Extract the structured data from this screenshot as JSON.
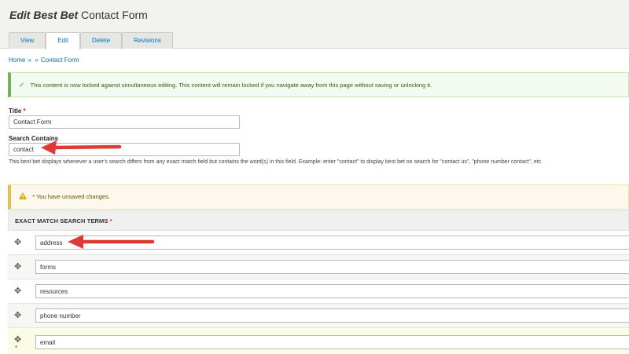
{
  "header": {
    "title_prefix": "Edit",
    "title_type": "Best Bet",
    "title_name": "Contact Form"
  },
  "tabs": [
    {
      "label": "View"
    },
    {
      "label": "Edit",
      "active": true
    },
    {
      "label": "Delete"
    },
    {
      "label": "Revisions"
    }
  ],
  "breadcrumb": {
    "home": "Home",
    "sep1": "»",
    "sep2": "»",
    "current": "Contact Form"
  },
  "status": {
    "text": "This content is now locked against simultaneous editing. This content will remain locked if you navigate away from this page without saving or unlocking it."
  },
  "form": {
    "title_label": "Title",
    "title_required": "*",
    "title_value": "Contact Form",
    "search_label": "Search Contains",
    "search_value": "contact",
    "search_description": "This best bet displays whenever a user's search differs from any exact match field but contains the word(s) in this field. Example: enter \"contact\" to display best bet on search for \"contact us\", \"phone number contact\", etc."
  },
  "warning": {
    "marker": "*",
    "text": "You have unsaved changes."
  },
  "exact_match": {
    "header": "EXACT MATCH SEARCH TERMS",
    "required": "*",
    "changed_marker": "*",
    "terms": [
      "address",
      "forms",
      "resources",
      "phone number",
      "email"
    ]
  },
  "colors": {
    "link": "#0074bd",
    "status_border": "#77b259",
    "warning_border": "#e0c050",
    "annotation_arrow": "#e03a36"
  },
  "icons": {
    "drag": "drag-handle-icon",
    "check": "checkmark-icon",
    "warning": "warning-icon"
  }
}
